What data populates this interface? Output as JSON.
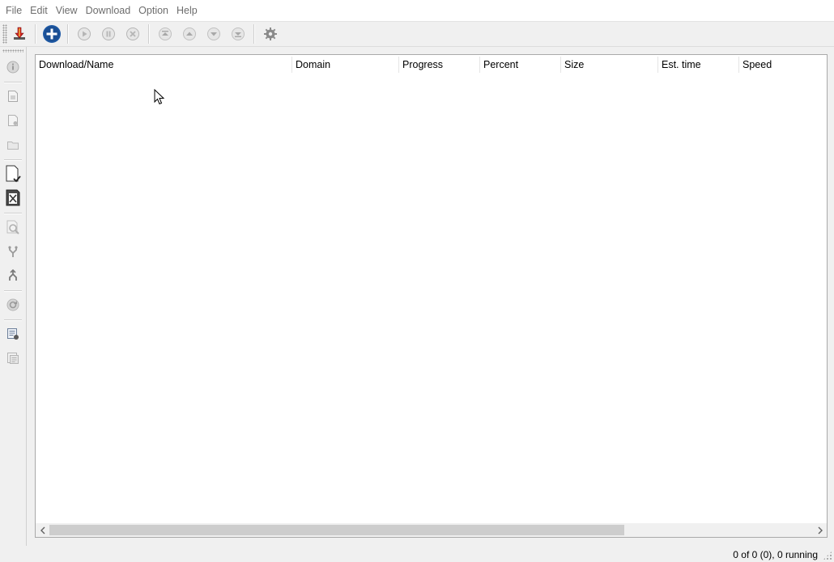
{
  "menu": {
    "items": [
      "File",
      "Edit",
      "View",
      "Download",
      "Option",
      "Help"
    ]
  },
  "toolbar": {
    "buttons": [
      {
        "name": "new-download",
        "icon": "download-arrow-icon"
      },
      {
        "name": "add",
        "icon": "plus-circle-icon"
      },
      {
        "name": "start",
        "icon": "play-icon"
      },
      {
        "name": "pause",
        "icon": "pause-icon"
      },
      {
        "name": "stop",
        "icon": "close-circle-icon"
      },
      {
        "name": "move-top",
        "icon": "arrow-top-icon"
      },
      {
        "name": "move-up",
        "icon": "arrow-up-icon"
      },
      {
        "name": "move-down",
        "icon": "arrow-down-icon"
      },
      {
        "name": "move-bottom",
        "icon": "arrow-bottom-icon"
      },
      {
        "name": "settings",
        "icon": "gear-icon"
      }
    ]
  },
  "sidebar": {
    "buttons": [
      "info-icon",
      "document-image-icon",
      "document-remove-icon",
      "folder-icon",
      "document-check-icon",
      "document-x-icon",
      "search-icon",
      "merge-icon",
      "split-icon",
      "refresh-icon",
      "list-add-icon",
      "list-icon"
    ]
  },
  "list": {
    "columns": [
      {
        "label": "Download/Name"
      },
      {
        "label": "Domain"
      },
      {
        "label": "Progress"
      },
      {
        "label": "Percent"
      },
      {
        "label": "Size"
      },
      {
        "label": "Est. time"
      },
      {
        "label": "Speed"
      }
    ],
    "rows": []
  },
  "status": {
    "text": "0 of 0 (0), 0 running"
  },
  "colors": {
    "accent": "#1f5aa6",
    "disabled_icon": "#a8a8a8"
  }
}
